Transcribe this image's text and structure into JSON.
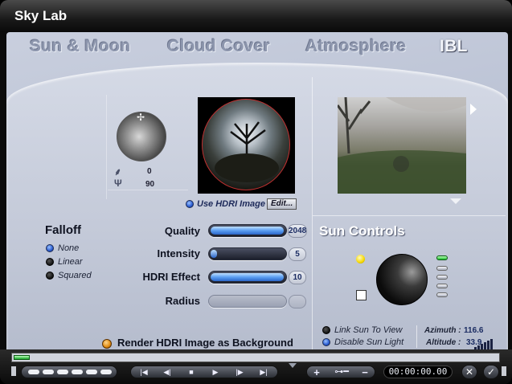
{
  "window": {
    "title": "Sky Lab"
  },
  "tabs": [
    {
      "label": "Sun & Moon",
      "active": false
    },
    {
      "label": "Cloud Cover",
      "active": false
    },
    {
      "label": "Atmosphere",
      "active": false
    },
    {
      "label": "IBL",
      "active": true
    }
  ],
  "sun_position": {
    "value_1": "0",
    "value_2": "90",
    "move_icon": "move-crosshair-icon",
    "icon_1": "tree-icon",
    "icon_2": "trident-icon"
  },
  "hdri": {
    "use_label": "Use HDRI Image",
    "edit_label": "Edit...",
    "use_checked": true
  },
  "falloff": {
    "heading": "Falloff",
    "options": [
      {
        "label": "None",
        "selected": true
      },
      {
        "label": "Linear",
        "selected": false
      },
      {
        "label": "Squared",
        "selected": false
      }
    ]
  },
  "sliders": [
    {
      "label": "Quality",
      "value": "2048",
      "fill_fraction": 0.97
    },
    {
      "label": "Intensity",
      "value": "5",
      "fill_fraction": 0.0
    },
    {
      "label": "HDRI Effect",
      "value": "10",
      "fill_fraction": 0.97
    },
    {
      "label": "Radius",
      "value": "",
      "fill_fraction": 0.0,
      "disabled": true
    }
  ],
  "render_background": {
    "label": "Render HDRI Image as Background"
  },
  "sun_controls": {
    "heading": "Sun Controls",
    "link_label": "Link Sun To View",
    "disable_label": "Disable Sun Light",
    "azimuth_label": "Azimuth :",
    "azimuth_value": "116.6",
    "altitude_label": "Altitude :",
    "altitude_value": "33.9"
  },
  "transport": {
    "timecode": "00:00:00.00",
    "buttons": [
      "|◀",
      "◀|",
      "■",
      "▶",
      "|▶",
      "▶|"
    ],
    "plus": "+",
    "minus": "−",
    "key_icon": "key-icon",
    "cancel": "✕",
    "confirm": "✓"
  },
  "colors": {
    "accent_blue": "#2a64c8",
    "panel": "#c3c9d8",
    "orange": "#e08a10",
    "yellow": "#f6d800"
  }
}
